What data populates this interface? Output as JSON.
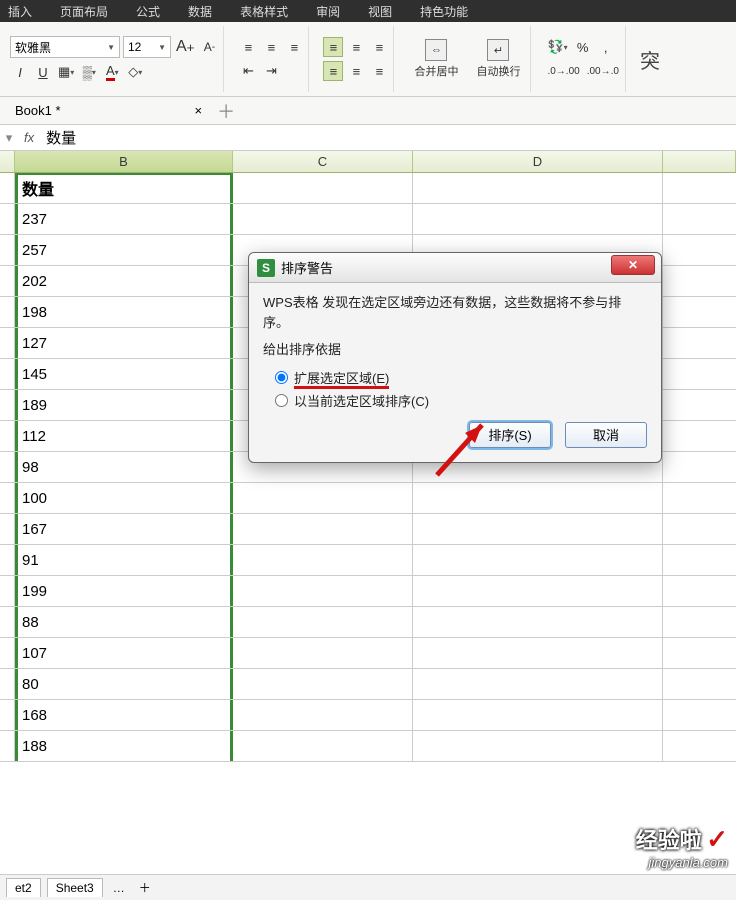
{
  "menu": {
    "insert": "插入",
    "layout": "页面布局",
    "formula": "公式",
    "data": "数据",
    "style": "表格样式",
    "review": "审阅",
    "view": "视图",
    "special": "持色功能"
  },
  "font": {
    "name": "软雅黑",
    "size": "12",
    "bigA": "A",
    "smallA": "A"
  },
  "toolbar": {
    "italic": "I",
    "underline": "U",
    "merge_label": "合并居中",
    "wrap_label": "自动换行",
    "overflow_label": "突",
    "percent": "%",
    "comma": ",",
    "inc_dec_top": ".0",
    "inc_dec_bot": ".00"
  },
  "tabs": {
    "doc": "Book1 *"
  },
  "formula": {
    "fx": "fx",
    "value": "数量"
  },
  "cols": {
    "b": "B",
    "c": "C",
    "d": "D"
  },
  "colB_header": "数量",
  "colB_values": [
    "237",
    "257",
    "202",
    "198",
    "127",
    "145",
    "189",
    "112",
    "98",
    "100",
    "167",
    "91",
    "199",
    "88",
    "107",
    "80",
    "168",
    "188"
  ],
  "sheets": {
    "t2": "et2",
    "t3": "Sheet3",
    "more": "…"
  },
  "dialog": {
    "title": "排序警告",
    "msg": "WPS表格 发现在选定区域旁边还有数据，这些数据将不参与排序。",
    "prompt": "给出排序依据",
    "opt1": "扩展选定区域(E)",
    "opt2": "以当前选定区域排序(C)",
    "ok": "排序(S)",
    "cancel": "取消"
  },
  "watermark": {
    "text": "经验啦",
    "url": "jingyanla.com"
  }
}
